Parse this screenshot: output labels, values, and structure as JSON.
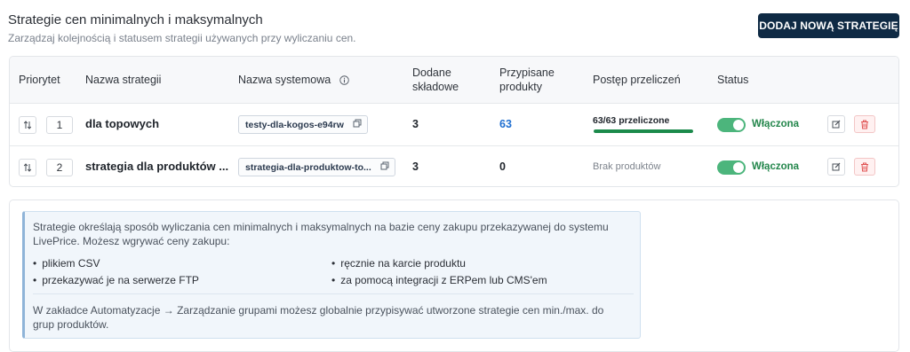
{
  "header": {
    "title": "Strategie cen minimalnych i maksymalnych",
    "subtitle": "Zarządzaj kolejnością i statusem strategii używanych przy wyliczaniu cen.",
    "add_button": "DODAJ NOWĄ STRATEGIĘ"
  },
  "table": {
    "columns": {
      "priority": "Priorytet",
      "name": "Nazwa strategii",
      "system_name": "Nazwa systemowa",
      "system_name_info_icon": "info-icon",
      "components_line1": "Dodane",
      "components_line2": "składowe",
      "products_line1": "Przypisane",
      "products_line2": "produkty",
      "progress": "Postęp przeliczeń",
      "status": "Status"
    },
    "rows": [
      {
        "priority": "1",
        "name": "dla topowych",
        "system_name": "testy-dla-kogos-e94rw",
        "components": "3",
        "products": "63",
        "products_color": "#1f6fd1",
        "progress_label": "63/63 przeliczone",
        "progress_value": 1.0,
        "status": "Włączona"
      },
      {
        "priority": "2",
        "name": "strategia dla produktów ...",
        "system_name": "strategia-dla-produktow-to...",
        "components": "3",
        "products": "0",
        "products_color": "#1f242b",
        "progress_label": "Brak produktów",
        "status": "Włączona"
      }
    ]
  },
  "info": {
    "text": "Strategie określają sposób wyliczania cen minimalnych i maksymalnych na bazie ceny zakupu przekazywanej do systemu LivePrice. Możesz wgrywać ceny zakupu:",
    "bullets": [
      "plikiem CSV",
      "ręcznie na karcie produktu",
      "przekazywać je na serwerze FTP",
      "za pomocą integracji z ERPem lub CMS'em"
    ],
    "footer": "W zakładce Automatyzacje → Zarządzanie grupami możesz globalnie przypisywać utworzone strategie cen min./max. do grup produktów."
  },
  "colors": {
    "primary": "#0f2a44",
    "success": "#23864b",
    "toggle_on": "#4cb57c",
    "link": "#1f6fd1",
    "danger": "#e05252"
  }
}
